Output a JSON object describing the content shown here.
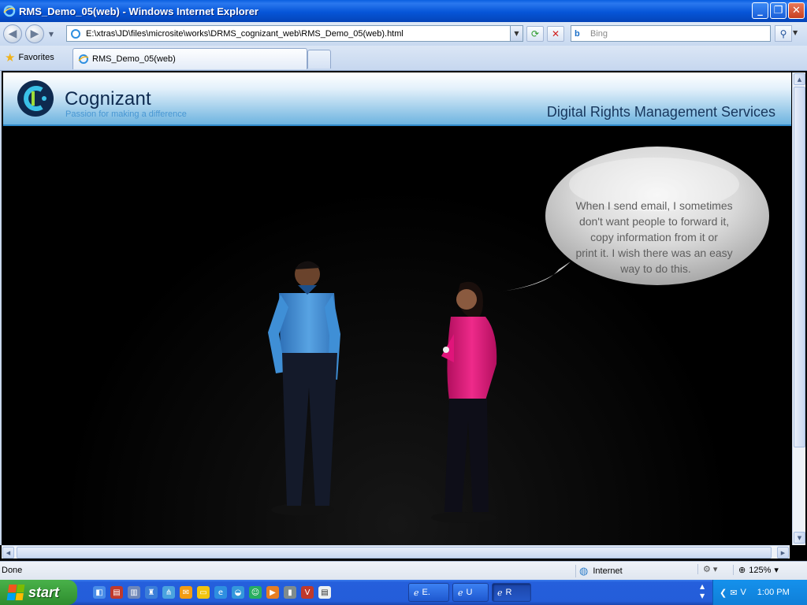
{
  "window": {
    "title": "RMS_Demo_05(web) - Windows Internet Explorer",
    "buttons": [
      "_",
      "❐",
      "✕"
    ]
  },
  "nav": {
    "address": "E:\\xtras\\JD\\files\\microsite\\works\\DRMS_cognizant_web\\RMS_Demo_05(web).html",
    "search_placeholder": "Bing"
  },
  "tabs": {
    "favorites_label": "Favorites",
    "active_tab_label": "RMS_Demo_05(web)"
  },
  "page": {
    "brand": "Cognizant",
    "tagline": "Passion for making a difference",
    "service_title": "Digital Rights Management Services",
    "speech_lines": [
      "When I send email, I sometimes",
      "don't want people to forward it,",
      "copy information from it or",
      "print it. I wish there was an easy",
      "way to do this."
    ]
  },
  "status": {
    "text": "Done",
    "zone": "Internet",
    "zoom": "125%"
  },
  "taskbar": {
    "start_label": "start",
    "tasks": [
      {
        "label": "E.",
        "active": false
      },
      {
        "label": "U",
        "active": false
      },
      {
        "label": "R",
        "active": true
      }
    ],
    "clock": "1:00 PM"
  },
  "colors": {
    "banner_accent": "#2f89c9",
    "brand_text": "#0e2a4f",
    "tagline": "#3c8fd0",
    "man_shirt": "#3f8fd6",
    "woman_top": "#e0147a"
  }
}
